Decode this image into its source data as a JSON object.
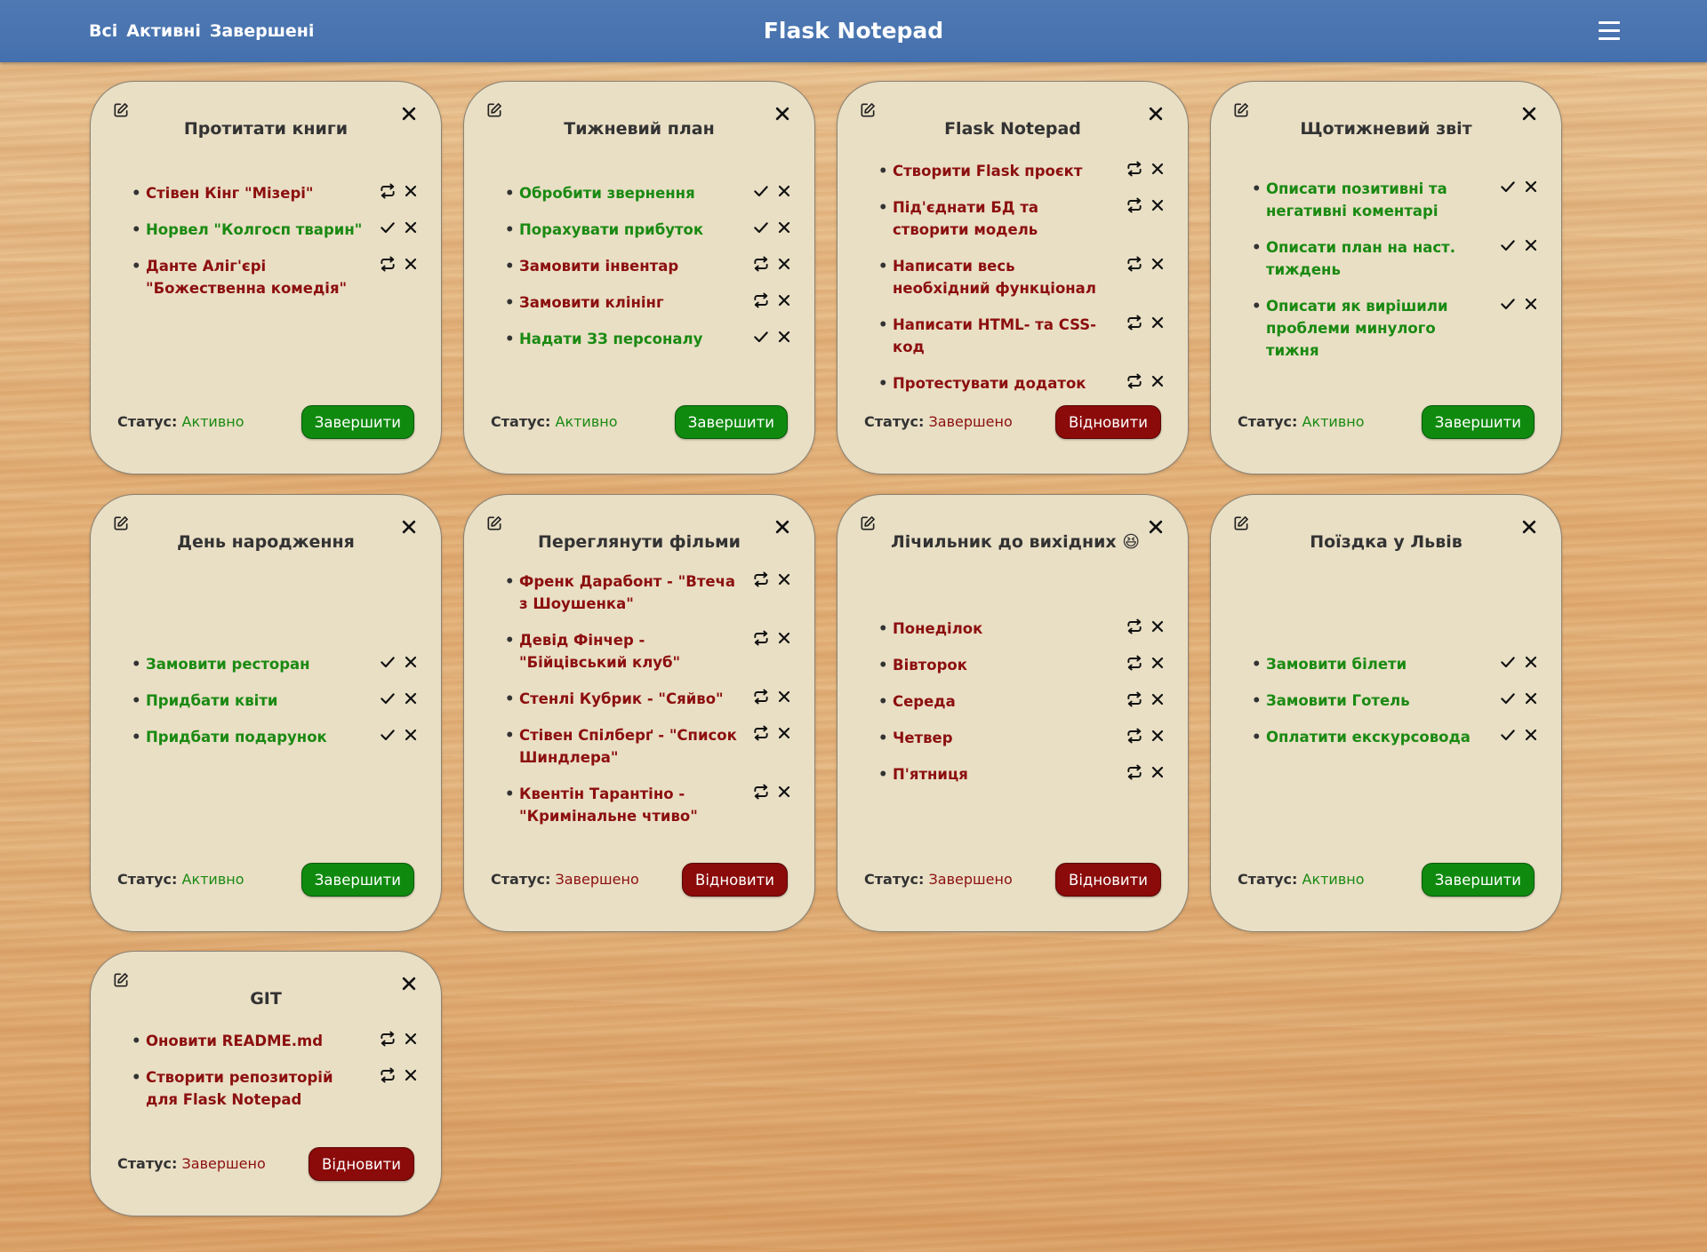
{
  "nav": {
    "links": [
      "Всі",
      "Активні",
      "Завершені"
    ],
    "brand": "Flask Notepad"
  },
  "status_prefix": "Статус:",
  "cards": [
    {
      "title": "Протитати книги",
      "status": "Активно",
      "button": "Завершити",
      "items": [
        {
          "text": "Стівен Кінг \"Мізері\"",
          "done": false
        },
        {
          "text": "Норвел \"Колгосп тварин\"",
          "done": true
        },
        {
          "text": "Данте Аліг'єрі \"Божественна комедія\"",
          "done": false
        }
      ]
    },
    {
      "title": "Тижневий план",
      "status": "Активно",
      "button": "Завершити",
      "items": [
        {
          "text": "Обробити звернення",
          "done": true
        },
        {
          "text": "Порахувати прибуток",
          "done": true
        },
        {
          "text": "Замовити інвентар",
          "done": false
        },
        {
          "text": "Замовити клінінг",
          "done": false
        },
        {
          "text": "Надати ЗЗ персоналу",
          "done": true
        }
      ]
    },
    {
      "title": "Flask Notepad",
      "status": "Завершено",
      "button": "Відновити",
      "items": [
        {
          "text": "Створити Flask проєкт",
          "done": false
        },
        {
          "text": "Під'єднати БД та створити модель",
          "done": false
        },
        {
          "text": "Написати весь необхідний функціонал",
          "done": false
        },
        {
          "text": "Написати HTML- та CSS-код",
          "done": false
        },
        {
          "text": "Протестувати додаток",
          "done": false
        }
      ]
    },
    {
      "title": "Щотижневий звіт",
      "status": "Активно",
      "button": "Завершити",
      "items": [
        {
          "text": "Описати позитивні та негативні коментарі",
          "done": true
        },
        {
          "text": "Описати план на наст. тиждень",
          "done": true
        },
        {
          "text": "Описати як вирішили проблеми минулого тижня",
          "done": true
        }
      ]
    },
    {
      "title": "День народження",
      "status": "Активно",
      "button": "Завершити",
      "items": [
        {
          "text": "Замовити ресторан",
          "done": true
        },
        {
          "text": "Придбати квіти",
          "done": true
        },
        {
          "text": "Придбати подарунок",
          "done": true
        }
      ]
    },
    {
      "title": "Переглянути фільми",
      "status": "Завершено",
      "button": "Відновити",
      "items": [
        {
          "text": "Френк Дарабонт - \"Втеча з Шоушенка\"",
          "done": false
        },
        {
          "text": "Девід Фінчер - \"Бійцівський клуб\"",
          "done": false
        },
        {
          "text": "Стенлі Кубрик - \"Сяйво\"",
          "done": false
        },
        {
          "text": "Стівен Спілберґ - \"Список Шиндлера\"",
          "done": false
        },
        {
          "text": "Квентін Тарантіно - \"Кримінальне чтиво\"",
          "done": false
        }
      ]
    },
    {
      "title": "Лічильник до вихідних 😆",
      "status": "Завершено",
      "button": "Відновити",
      "items": [
        {
          "text": "Понеділок",
          "done": false
        },
        {
          "text": "Вівторок",
          "done": false
        },
        {
          "text": "Середа",
          "done": false
        },
        {
          "text": "Четвер",
          "done": false
        },
        {
          "text": "П'ятниця",
          "done": false
        }
      ]
    },
    {
      "title": "Поїздка у Львів",
      "status": "Активно",
      "button": "Завершити",
      "items": [
        {
          "text": "Замовити білети",
          "done": true
        },
        {
          "text": "Замовити Готель",
          "done": true
        },
        {
          "text": "Оплатити екскурсовода",
          "done": true
        }
      ]
    },
    {
      "title": "GIT",
      "status": "Завершено",
      "button": "Відновити",
      "items": [
        {
          "text": "Оновити README.md",
          "done": false
        },
        {
          "text": "Створити репозиторій для Flask Notepad",
          "done": false
        }
      ]
    }
  ],
  "colors": {
    "navbar": "#4a74b0",
    "card_bg": "#e9dfc5",
    "done_text": "#1a8a12",
    "todo_text": "#8c0f0f",
    "complete_button": "#0f8a0f",
    "restore_button": "#8b0a0a"
  },
  "icons": {
    "edit": "edit-icon",
    "close": "close-icon",
    "check": "check-icon",
    "repeat": "repeat-icon",
    "remove": "remove-icon",
    "menu": "hamburger-menu-icon"
  }
}
